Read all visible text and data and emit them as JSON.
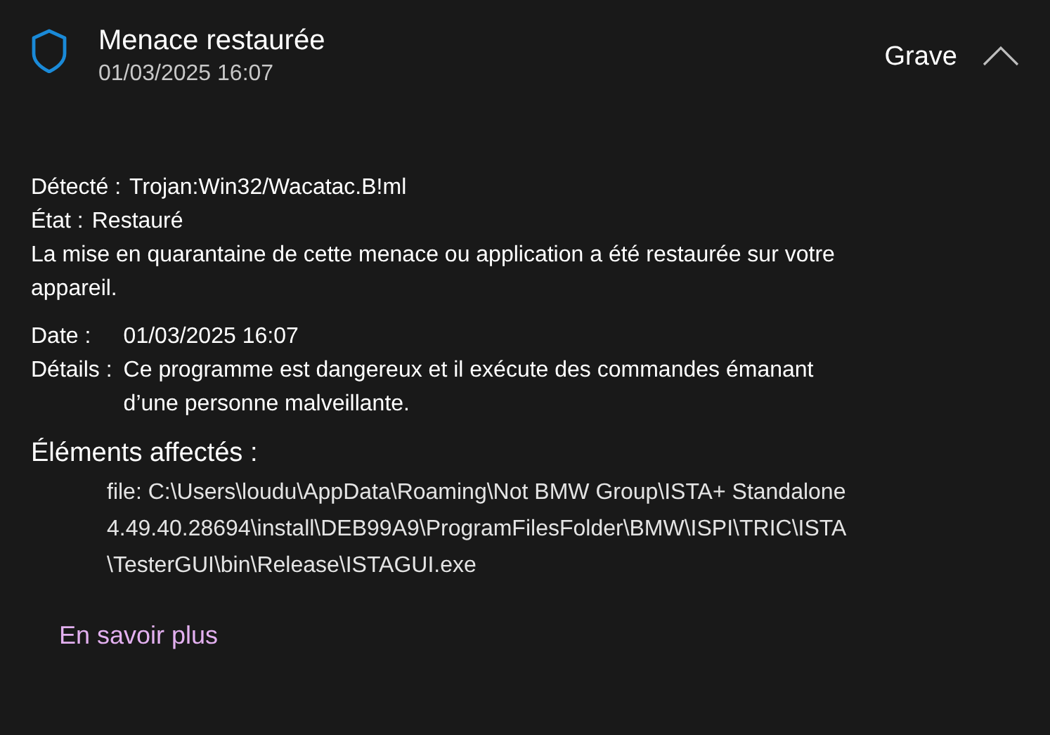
{
  "header": {
    "title": "Menace restaurée",
    "timestamp": "01/03/2025 16:07",
    "severity": "Grave",
    "expanded": true
  },
  "status": [
    {
      "label": "Détecté :",
      "value": "Trojan:Win32/Wacatac.B!ml"
    },
    {
      "label": "État :",
      "value": "Restauré"
    }
  ],
  "message": [
    "La mise en quarantaine de cette menace ou application a été restaurée sur votre",
    "appareil."
  ],
  "info": [
    {
      "label": "Date :",
      "value": [
        "01/03/2025 16:07"
      ]
    },
    {
      "label": "Détails :",
      "value": [
        "Ce programme est dangereux et il exécute des commandes émanant",
        "d’une personne malveillante."
      ]
    }
  ],
  "affected": {
    "heading": "Éléments affectés :",
    "path": [
      "file: C:\\Users\\loudu\\AppData\\Roaming\\Not BMW Group\\ISTA+ Standalone",
      "4.49.40.28694\\install\\DEB99A9\\ProgramFilesFolder\\BMW\\ISPI\\TRIC\\ISTA",
      "\\TesterGUI\\bin\\Release\\ISTAGUI.exe"
    ]
  },
  "link": "En savoir plus"
}
